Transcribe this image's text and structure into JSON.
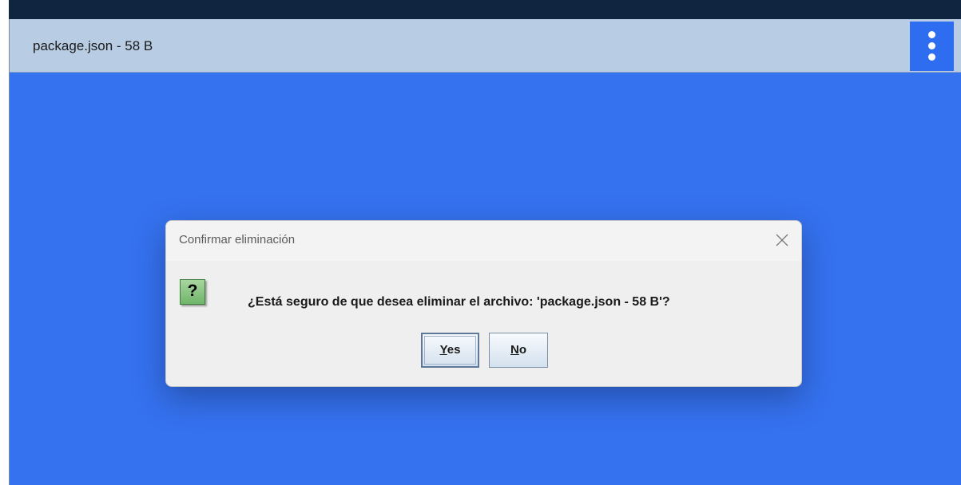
{
  "file_panel": {
    "title": "package.json - 58 B",
    "menu_icon": "vertical-ellipsis-icon"
  },
  "dialog": {
    "title": "Confirmar eliminación",
    "close_icon": "close-icon",
    "question_icon": "question-icon",
    "question_glyph": "?",
    "message": "¿Está seguro de que desea eliminar el archivo: 'package.json - 58 B'?",
    "yes_mnemonic": "Y",
    "yes_rest": "es",
    "no_mnemonic": "N",
    "no_rest": "o"
  },
  "colors": {
    "background_blue": "#3572ef",
    "header_bar": "#b8cde3",
    "top_bar": "#0f2540",
    "menu_button": "#2f6df0",
    "dialog_bg": "#efefef",
    "question_icon_green": "#6fb56a"
  }
}
